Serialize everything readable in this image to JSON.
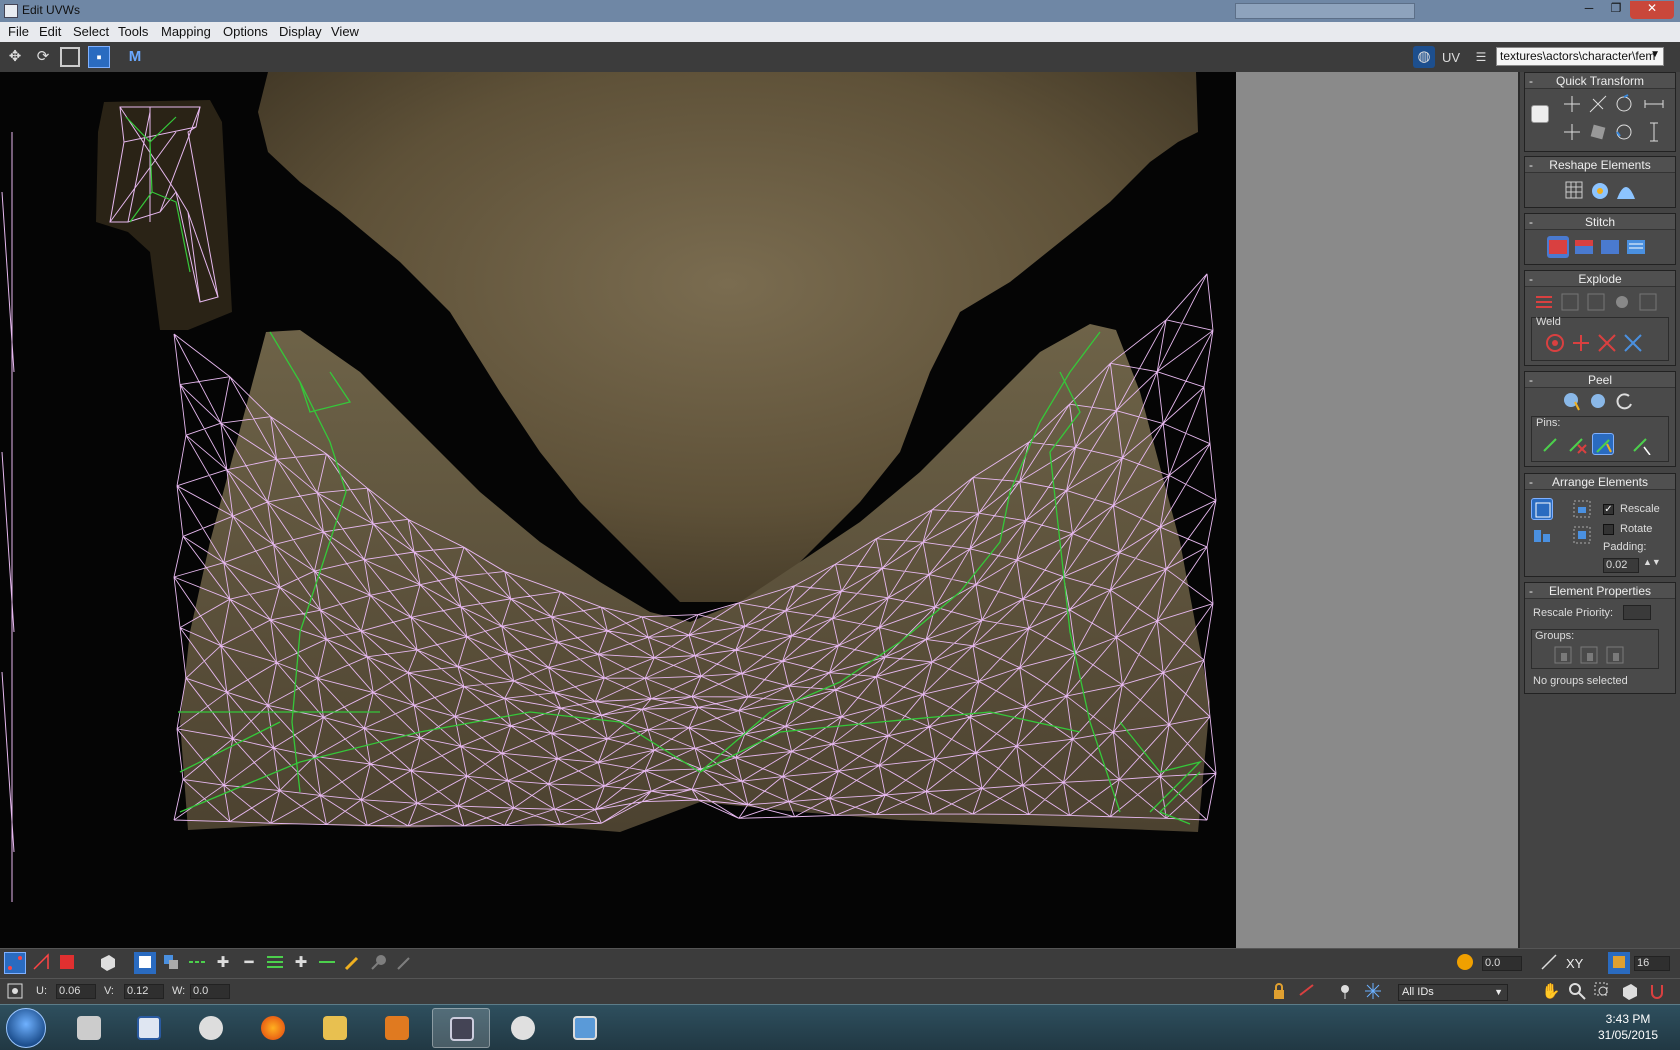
{
  "window": {
    "title": "Edit UVWs",
    "minimize_glyph": "─",
    "restore_glyph": "❐",
    "close_glyph": "✕",
    "close_color": "#c9473b"
  },
  "menu": [
    "File",
    "Edit",
    "Select",
    "Tools",
    "Mapping",
    "Options",
    "Display",
    "View"
  ],
  "toolbar": {
    "uv_label": "UV",
    "texture_dropdown": "textures\\actors\\character\\fem"
  },
  "panel": {
    "quick_transform": "Quick Transform",
    "reshape_elements": "Reshape Elements",
    "stitch": "Stitch",
    "explode": "Explode",
    "weld": "Weld",
    "peel": "Peel",
    "pins": "Pins:",
    "arrange_elements": "Arrange Elements",
    "rescale": "Rescale",
    "rescale_checked": true,
    "rotate": "Rotate",
    "rotate_checked": false,
    "padding_label": "Padding:",
    "padding_value": "0.02",
    "element_properties": "Element Properties",
    "rescale_priority": "Rescale Priority:",
    "groups": "Groups:",
    "no_groups": "No groups selected"
  },
  "bottom": {
    "soft_value": "0.0",
    "axis_label": "XY",
    "grid_value": "16",
    "u_label": "U:",
    "u_value": "0.06",
    "v_label": "V:",
    "v_value": "0.12",
    "w_label": "W:",
    "w_value": "0.0",
    "id_filter": "All IDs"
  },
  "taskbar": {
    "time": "3:43 PM",
    "date": "31/05/2015"
  },
  "colors": {
    "wire_pink": "#e6b8ef",
    "wire_green": "#35c83a",
    "accent_blue": "#2a6bc0",
    "fabric": "#6d5f43"
  },
  "icons": {
    "toolbar": [
      "move-icon",
      "rotate-icon",
      "scale-icon",
      "freeform-icon",
      "mirror-icon"
    ],
    "taskbar": [
      "windows-start",
      "app-icon",
      "data-explorer-icon",
      "skyrim-icon",
      "firefox-icon",
      "folder-icon",
      "media-player-icon",
      "3dsmax-icon",
      "paint-icon",
      "picture-icon"
    ]
  }
}
